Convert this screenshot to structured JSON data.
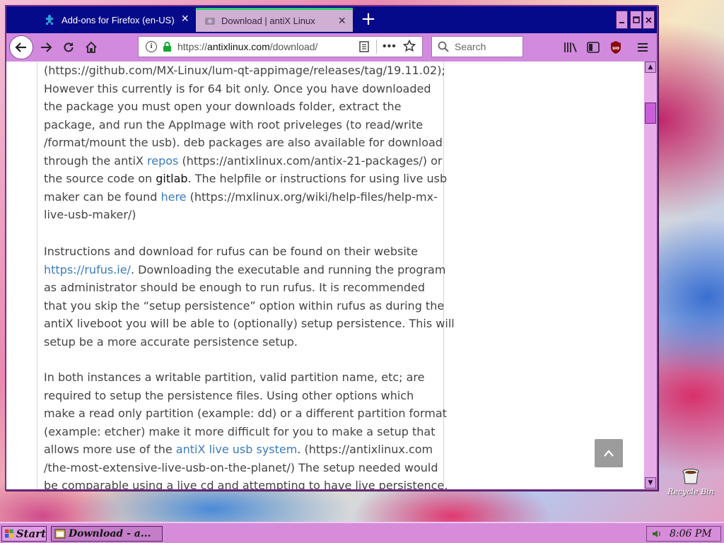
{
  "browser": {
    "tabs": [
      {
        "title": "Add-ons for Firefox (en-US)",
        "active": false
      },
      {
        "title": "Download | antiX Linux",
        "active": true
      }
    ],
    "new_tab_symbol": "+",
    "window_buttons": [
      "minimize",
      "maximize",
      "close"
    ],
    "url": {
      "prefix": "https://",
      "host": "antixlinux.com",
      "path": "/download/"
    },
    "search_placeholder": "Search",
    "accent_color": "#050a8a",
    "active_tab_indicator_color": "#2ecc71"
  },
  "page": {
    "paragraphs": [
      {
        "lines": [
          [
            {
              "t": "(https://github.com/MX-Linux/lum-qt-appimage/releases/tag/19.11.02);"
            }
          ],
          [
            {
              "t": "However this currently is for 64 bit only. Once you have downloaded"
            }
          ],
          [
            {
              "t": "the package you must open your downloads folder, extract the"
            }
          ],
          [
            {
              "t": "package, and run the AppImage with root priveleges (to read/write"
            }
          ],
          [
            {
              "t": "/format/mount the usb). deb packages are also available for download"
            }
          ],
          [
            {
              "t": "through the antiX "
            },
            {
              "t": "repos",
              "link": true
            },
            {
              "t": " (https://antixlinux.com/antix-21-packages/) or"
            }
          ],
          [
            {
              "t": "the source code on "
            },
            {
              "t": "gitlab",
              "dark": true
            },
            {
              "t": ". The helpfile or instructions for using live usb"
            }
          ],
          [
            {
              "t": "maker can be found "
            },
            {
              "t": "here",
              "link": true
            },
            {
              "t": " (https://mxlinux.org/wiki/help-files/help-mx-"
            }
          ],
          [
            {
              "t": "live-usb-maker/)"
            }
          ]
        ]
      },
      {
        "lines": [
          [
            {
              "t": "Instructions and download for rufus can be found on their website"
            }
          ],
          [
            {
              "t": "https://rufus.ie/",
              "link": true
            },
            {
              "t": ". Downloading the executable and running the program"
            }
          ],
          [
            {
              "t": "as administrator should be enough to run rufus. It is recommended"
            }
          ],
          [
            {
              "t": "that you skip the “setup persistence” option within rufus as during the"
            }
          ],
          [
            {
              "t": "antiX liveboot you will be able to (optionally) setup persistence. This will"
            }
          ],
          [
            {
              "t": "setup be a more accurate persistence setup."
            }
          ]
        ]
      },
      {
        "lines": [
          [
            {
              "t": "In both instances a writable partition, valid partition name, etc; are"
            }
          ],
          [
            {
              "t": "required to setup the persistence files. Using other options which"
            }
          ],
          [
            {
              "t": "make a read only partition (example: dd) or a different partition format"
            }
          ],
          [
            {
              "t": "(example: etcher) make it more difficult for you to make a setup that"
            }
          ],
          [
            {
              "t": "allows more use of the "
            },
            {
              "t": "antiX live usb system",
              "link": true
            },
            {
              "t": ". (https://antixlinux.com"
            }
          ],
          [
            {
              "t": "/the-most-extensive-live-usb-on-the-planet/) The setup needed would"
            }
          ],
          [
            {
              "t": "be comparable using a live cd and attempting to have live persistence."
            }
          ]
        ]
      }
    ],
    "link_color": "#3a7bbf",
    "text_color": "#444444"
  },
  "desktop": {
    "recycle_bin_label": "Recycle Bin"
  },
  "taskbar": {
    "start_label": "Start",
    "task_label": "Download - a...",
    "clock": "8:06 PM"
  }
}
